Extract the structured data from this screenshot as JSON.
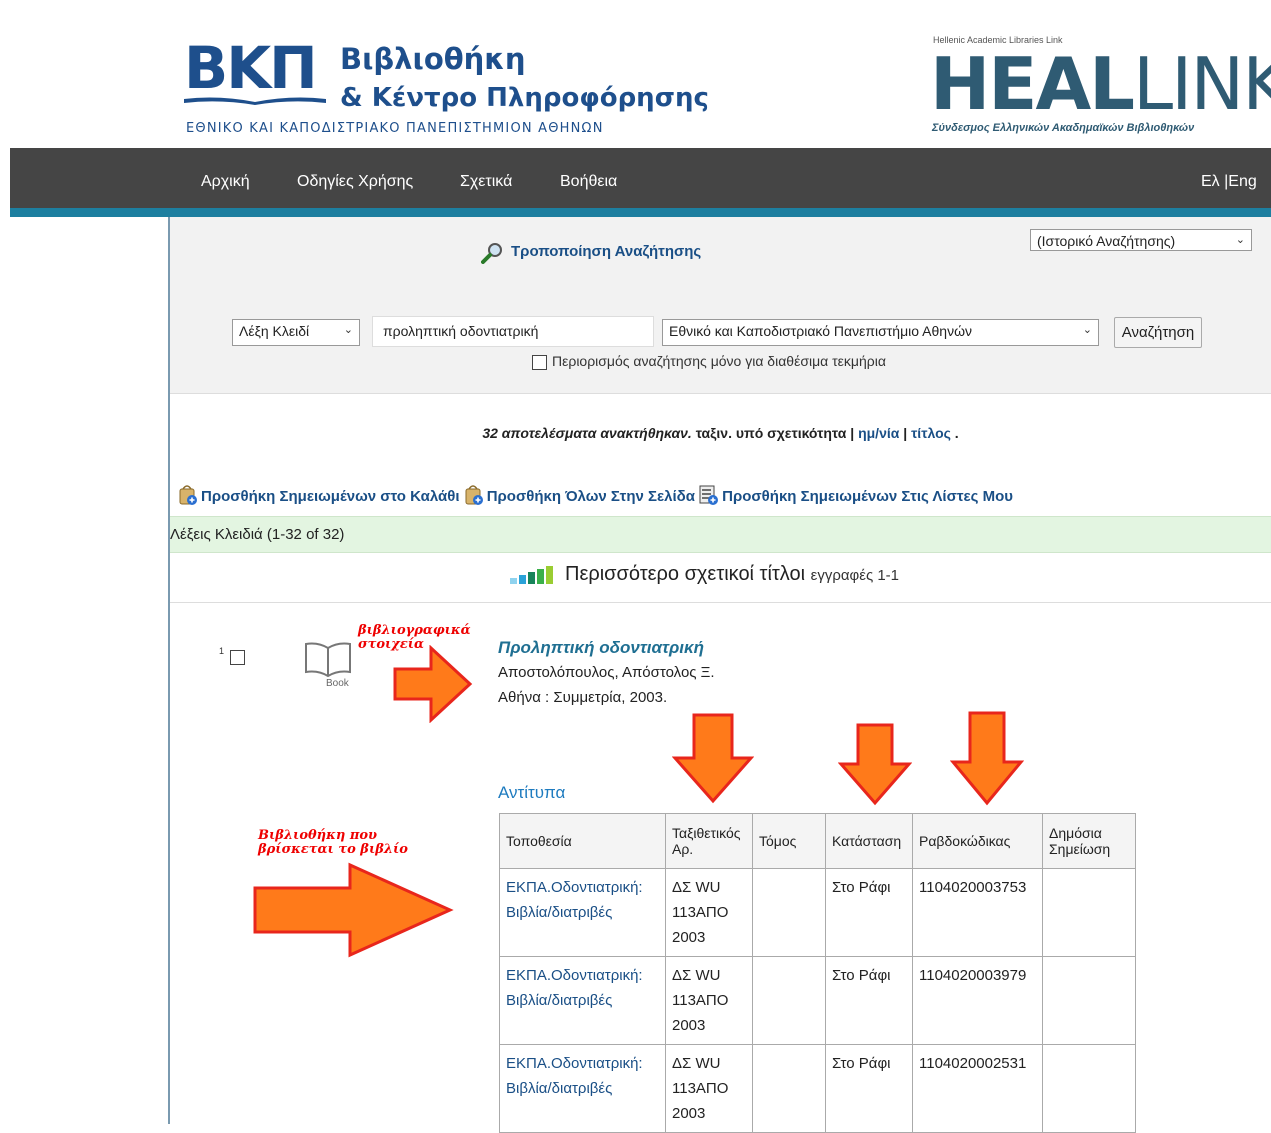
{
  "header": {
    "logo_mark": "ΒΚΠ",
    "logo_line1": "Βιβλιοθήκη",
    "logo_line2": "& Κέντρο Πληροφόρησης",
    "logo_sub": "ΕΘΝΙΚΟ ΚΑΙ ΚΑΠΟΔΙΣΤΡΙΑΚΟ ΠΑΝΕΠΙΣΤΗΜΙΟΝ ΑΘΗΝΩΝ",
    "partner_top": "Hellenic Academic Libraries Link",
    "partner_bold": "HEAL",
    "partner_thin": "LINK",
    "partner_sub": "Σύνδεσμος Ελληνικών Ακαδημαϊκών Βιβλιοθηκών"
  },
  "nav": {
    "home": "Αρχική",
    "guide": "Οδηγίες Χρήσης",
    "about": "Σχετικά",
    "help": "Βοήθεια",
    "lang": "Ελ |Eng"
  },
  "search": {
    "modify_label": "Τροποποίηση Αναζήτησης",
    "history_select": "(Ιστορικό Αναζήτησης)",
    "field_select": "Λέξη Κλειδί",
    "term_value": "προληπτική οδοντιατρική",
    "scope_select": "Εθνικό και Καποδιστριακό Πανεπιστήμιο Αθηνών",
    "search_button": "Αναζήτηση",
    "available_only_label": "Περιορισμός αναζήτησης μόνο για διαθέσιμα τεκμήρια"
  },
  "results": {
    "count_text": "32 αποτελέσματα ανακτήθηκαν.",
    "sort_text": "ταξιν. υπό σχετικότητα |",
    "sort_date": "ημ/νία",
    "sort_sep": "|",
    "sort_title": "τίτλος",
    "sort_end": ".",
    "action_add_marked_cart": "Προσθήκη Σημειωμένων στο Καλάθι",
    "action_add_all_page": "Προσθήκη Όλων Στην Σελίδα",
    "action_add_marked_lists": "Προσθήκη Σημειωμένων Στις Λίστες Μου",
    "keyword_bar": "Λέξεις Κλειδιά (1-32 of 32)",
    "relevant_title": "Περισσότερο σχετικοί τίτλοι",
    "relevant_range": "εγγραφές 1-1"
  },
  "record": {
    "number": "1",
    "format": "Book",
    "title": "Προληπτική οδοντιατρική",
    "author": "Αποστολόπουλος, Απόστολος Ξ.",
    "publication": "Αθήνα : Συμμετρία, 2003."
  },
  "annotations": {
    "bib_line1": "βιβλιογραφικά",
    "bib_line2": "στοιχεία",
    "lib_line1": "Βιβλιοθήκη που",
    "lib_line2": "βρίσκεται το βιβλίο"
  },
  "holdings": {
    "label": "Αντίτυπα",
    "headers": [
      "Τοποθεσία",
      "Ταξιθετικός Αρ.",
      "Τόμος",
      "Κατάσταση",
      "Ραβδοκώδικας",
      "Δημόσια Σημείωση"
    ],
    "rows": [
      {
        "location": "ΕΚΠΑ.Οδοντιατρική: Βιβλία/διατριβές",
        "call": "ΔΣ WU 113ΑΠΟ 2003",
        "volume": "",
        "status": "Στο Ράφι",
        "barcode": "1104020003753",
        "note": ""
      },
      {
        "location": "ΕΚΠΑ.Οδοντιατρική: Βιβλία/διατριβές",
        "call": "ΔΣ WU 113ΑΠΟ 2003",
        "volume": "",
        "status": "Στο Ράφι",
        "barcode": "1104020003979",
        "note": ""
      },
      {
        "location": "ΕΚΠΑ.Οδοντιατρική: Βιβλία/διατριβές",
        "call": "ΔΣ WU 113ΑΠΟ 2003",
        "volume": "",
        "status": "Στο Ράφι",
        "barcode": "1104020002531",
        "note": ""
      }
    ]
  },
  "colors": {
    "brand_blue": "#1e4f8c",
    "nav_bg": "#454545",
    "nav_accent": "#1d7fa0",
    "arrow_orange": "#ff7a1a",
    "arrow_red": "#e8261c"
  }
}
